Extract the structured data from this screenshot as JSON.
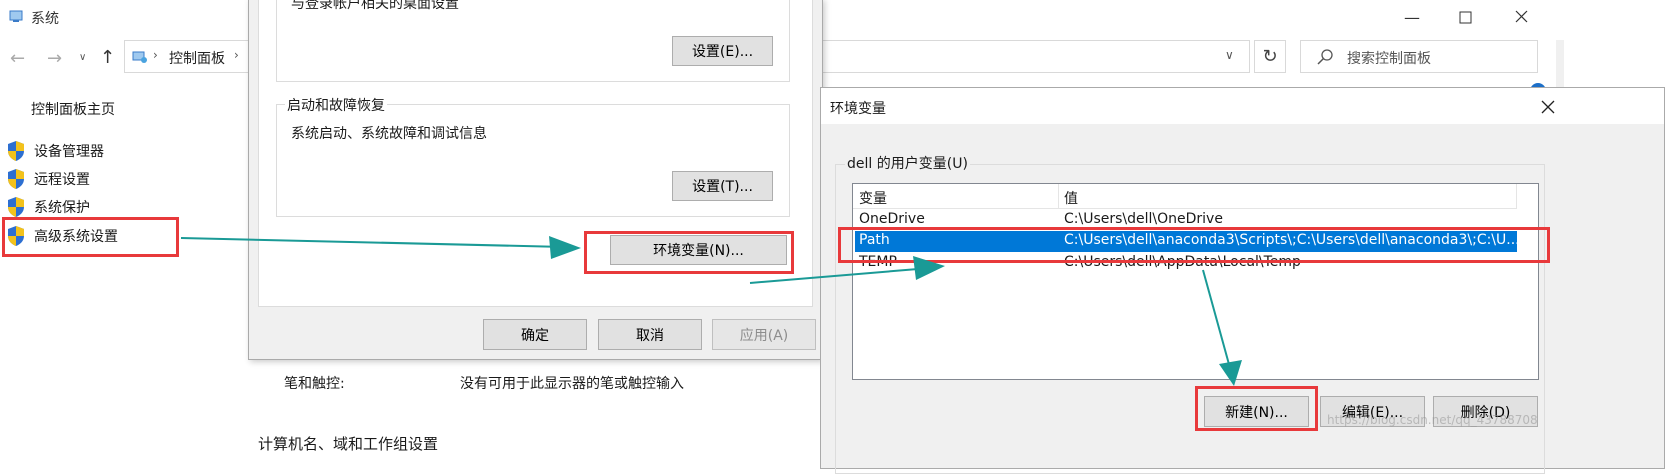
{
  "window": {
    "title": "系统",
    "breadcrumb": [
      "控制面板"
    ],
    "search_placeholder": "搜索控制面板"
  },
  "sidebar": {
    "home": "控制面板主页",
    "items": [
      {
        "label": "设备管理器"
      },
      {
        "label": "远程设置"
      },
      {
        "label": "系统保护"
      },
      {
        "label": "高级系统设置"
      }
    ]
  },
  "sysprops": {
    "top_text": "与登录帐户相关的桌面设置",
    "settings_button_1": "设置(E)...",
    "startup_group_title": "启动和故障恢复",
    "startup_desc": "系统启动、系统故障和调试信息",
    "settings_button_2": "设置(T)...",
    "env_button": "环境变量(N)...",
    "ok": "确定",
    "cancel": "取消",
    "apply": "应用(A)"
  },
  "background": {
    "pen_label": "笔和触控:",
    "pen_value": "没有可用于此显示器的笔或触控输入",
    "bottom_cut": "计算机名、域和工作组设置"
  },
  "envdialog": {
    "title": "环境变量",
    "user_group_title": "dell 的用户变量(U)",
    "col_var": "变量",
    "col_value": "值",
    "rows": [
      {
        "name": "OneDrive",
        "value": "C:\\Users\\dell\\OneDrive"
      },
      {
        "name": "Path",
        "value": "C:\\Users\\dell\\anaconda3\\Scripts\\;C:\\Users\\dell\\anaconda3\\;C:\\U..."
      },
      {
        "name": "TEMP",
        "value": "C:\\Users\\dell\\AppData\\Local\\Temp"
      }
    ],
    "new_button": "新建(N)...",
    "edit_button": "编辑(E)...",
    "delete_button": "删除(D)"
  },
  "watermark": "https://blog.csdn.net/qq_43788708",
  "colors": {
    "selection": "#0078d7",
    "annotation_red": "#e8393b",
    "annotation_arrow": "#1a9a96"
  }
}
